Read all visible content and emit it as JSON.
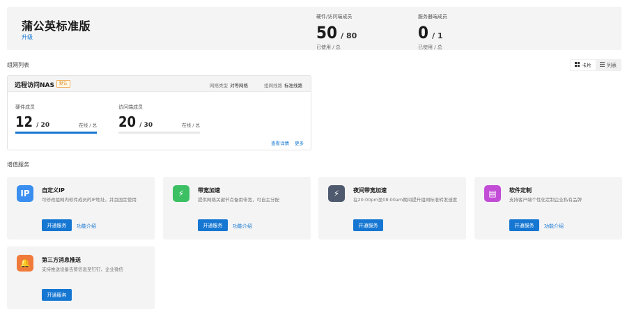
{
  "plan": {
    "name": "蒲公英标准版",
    "upgrade_label": "升级",
    "stats": [
      {
        "label": "硬件/访问端成员",
        "used": "50",
        "total": "/ 80",
        "sub": "已使用 / 总"
      },
      {
        "label": "服务器端成员",
        "used": "0",
        "total": "/ 1",
        "sub": "已使用 / 总"
      }
    ]
  },
  "network_section": {
    "title": "组网列表",
    "view_toggle": [
      {
        "label": "卡片",
        "icon": "grid-icon",
        "active": true
      },
      {
        "label": "列表",
        "icon": "list-icon",
        "active": false
      }
    ]
  },
  "network_card": {
    "name": "远程访问NAS",
    "badge": "默认",
    "type_label": "网络类型",
    "type_value": "对等网络",
    "line_label": "组网线路",
    "line_value": "标准线路",
    "members": [
      {
        "label": "硬件成员",
        "online": "12",
        "total": "/ 20",
        "status_label": "在线 / 总",
        "ratio": 1.0
      },
      {
        "label": "访问端成员",
        "online": "20",
        "total": "/ 30",
        "status_label": "在线 / 总",
        "ratio": 0.0
      }
    ],
    "links": [
      "查看详情",
      "更多"
    ]
  },
  "services_section": {
    "title": "增值服务",
    "items": [
      {
        "title": "自定义IP",
        "desc": "可修改组网内软件成员的IP地址，并且固定使用",
        "icon": "ip-icon",
        "icon_text": "IP",
        "icon_color": "#3a8ef0",
        "open_label": "开通服务",
        "intro_label": "功能介绍"
      },
      {
        "title": "带宽加速",
        "desc": "提供网络关键节点备用带宽，可自主分配",
        "icon": "lightning-icon",
        "icon_text": "⚡",
        "icon_color": "#3cc063",
        "open_label": "开通服务",
        "intro_label": "功能介绍"
      },
      {
        "title": "夜间带宽加速",
        "desc": "在20:00pm至08:00am期间提升组网标准转发速度",
        "icon": "night-lightning-icon",
        "icon_text": "⚡",
        "icon_color": "#4f5a6e",
        "open_label": "开通服务",
        "intro_label": ""
      },
      {
        "title": "软件定制",
        "desc": "支持客户端个性化定制企业私有品牌",
        "icon": "custom-software-icon",
        "icon_text": "▤",
        "icon_color": "#c24cd6",
        "open_label": "开通服务",
        "intro_label": "功能介绍"
      },
      {
        "title": "第三方消息推送",
        "desc": "支持推送设备告警信息至钉钉、企业微信",
        "icon": "bell-icon",
        "icon_text": "🔔",
        "icon_color": "#f07a3a",
        "open_label": "开通服务",
        "intro_label": ""
      }
    ]
  }
}
